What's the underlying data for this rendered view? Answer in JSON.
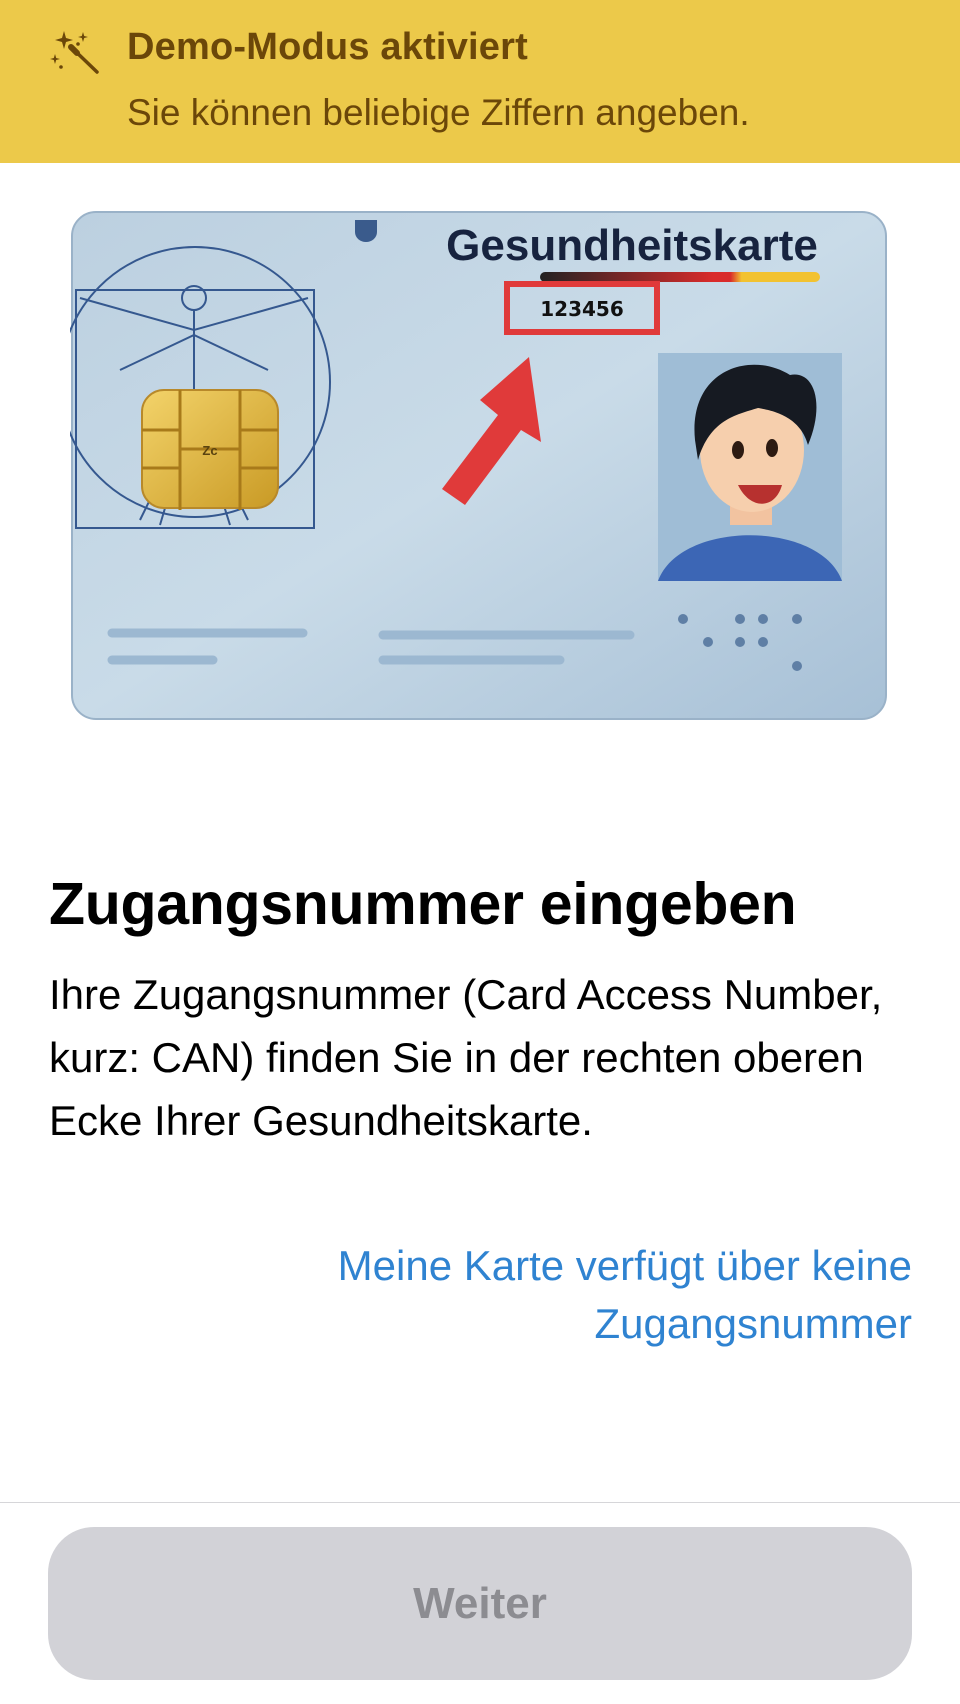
{
  "banner": {
    "icon": "magic-wand-sparkles-icon",
    "title": "Demo-Modus aktiviert",
    "subtitle": "Sie können beliebige Ziffern angeben.",
    "background_color": "#ecc94a",
    "text_color": "#6b4709"
  },
  "card_illustration": {
    "card_title": "Gesundheitskarte",
    "can_number": "123456",
    "highlight_color": "#e03a3a",
    "icons": [
      "vitruvian-man-icon",
      "chip-icon",
      "arrow-icon",
      "avatar-icon"
    ]
  },
  "main": {
    "title": "Zugangsnummer eingeben",
    "description": "Ihre Zugangsnummer (Card Access Number, kurz: CAN) finden Sie in der rechten oberen Ecke Ihrer Gesundheitskarte.",
    "no_can_link": "Meine Karte verfügt über keine Zugangsnummer",
    "link_color": "#2f83d1"
  },
  "footer": {
    "continue_label": "Weiter",
    "continue_enabled": false
  }
}
